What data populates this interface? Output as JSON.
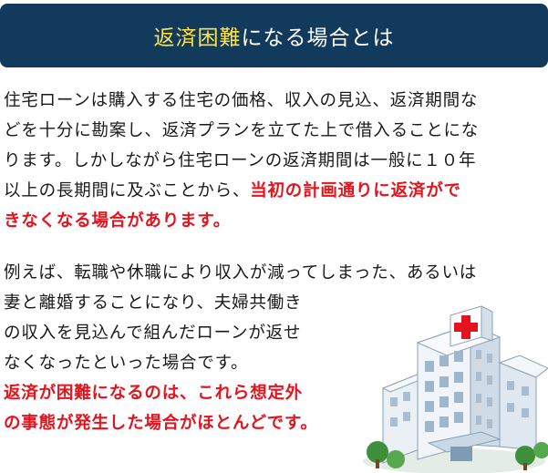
{
  "header": {
    "title_highlight": "返済困難",
    "title_rest": "になる場合とは",
    "bg_color": "#113a5d",
    "highlight_color": "#ffe24a"
  },
  "paragraph1": {
    "lines": [
      "住宅ローンは購入する住宅の価格、収入の見込、返済期間な",
      "どを十分に勘案し、返済プランを立てた上で借入ることにな",
      "ります。しかしながら住宅ローンの返済期間は一般に１０年",
      "以上の長期間に及ぶことから、"
    ],
    "emphasis_line4": "当初の計画通りに返済がで",
    "emphasis_line5": "きなくなる場合があります。"
  },
  "paragraph2": {
    "lines": [
      "例えば、転職や休職により収入が減ってしまった、あるいは",
      "妻と離婚することになり、夫婦共働き",
      "の収入を見込んで組んだローンが返せ",
      "なくなったといった場合です。"
    ],
    "emphasis_lines": [
      "返済が困難になるのは、これら想定外",
      "の事態が発生した場合がほとんどです。"
    ]
  },
  "colors": {
    "emphasis": "#e3141d",
    "text": "#1a1a1a"
  },
  "illustration": {
    "icon": "hospital-building-icon"
  }
}
